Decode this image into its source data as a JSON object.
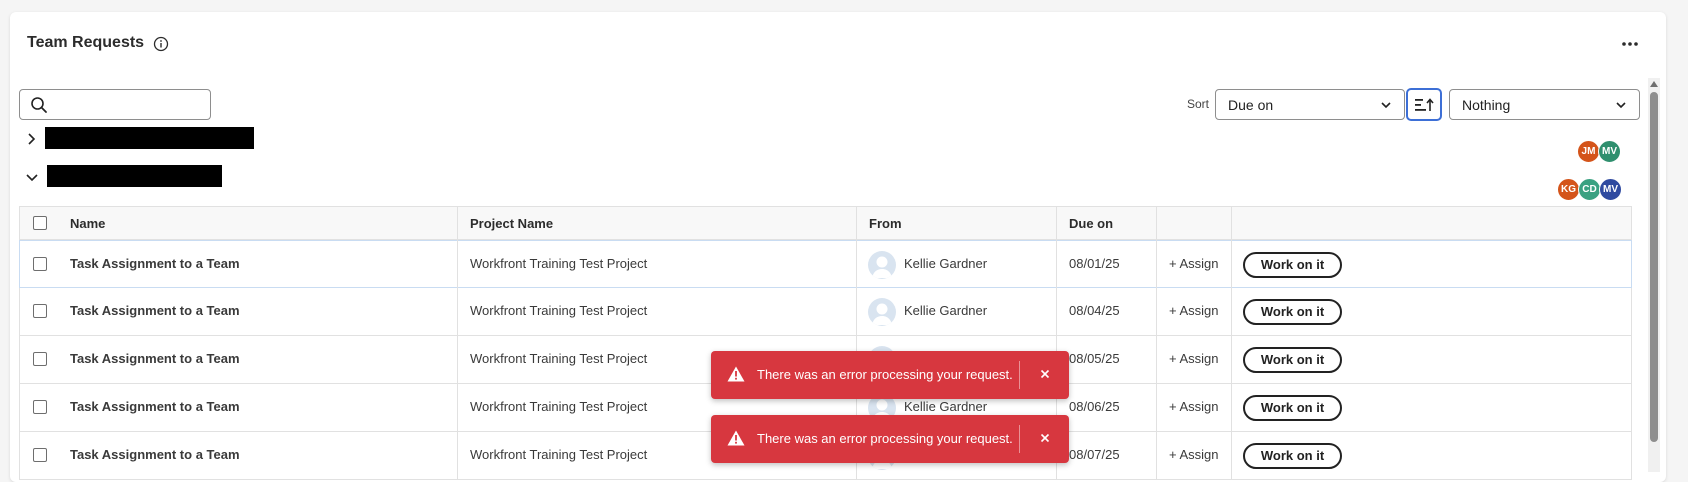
{
  "header": {
    "title": "Team Requests",
    "info_icon": "info-icon",
    "more_icon": "more-horizontal-icon"
  },
  "search": {
    "value": "",
    "placeholder": "",
    "icon": "search-icon"
  },
  "sort": {
    "label": "Sort",
    "field": "Due on",
    "direction_icon": "sort-ascending-icon",
    "group_by": "Nothing"
  },
  "groups": [
    {
      "name": "",
      "expanded": false,
      "avatars": [
        {
          "initials": "JM",
          "color": "#d4541a"
        },
        {
          "initials": "MV",
          "color": "#2f8f6e"
        }
      ]
    },
    {
      "name": "",
      "expanded": true,
      "avatars": [
        {
          "initials": "KG",
          "color": "#d4541a"
        },
        {
          "initials": "CD",
          "color": "#3aa181"
        },
        {
          "initials": "MV",
          "color": "#2f4aa0"
        }
      ]
    }
  ],
  "table": {
    "columns": [
      "Name",
      "Project Name",
      "From",
      "Due on",
      "",
      ""
    ],
    "rows": [
      {
        "name": "Task Assignment to a Team",
        "project": "Workfront Training Test Project",
        "from": "Kellie Gardner",
        "due": "08/01/25",
        "assign": "+ Assign",
        "action": "Work on it"
      },
      {
        "name": "Task Assignment to a Team",
        "project": "Workfront Training Test Project",
        "from": "Kellie Gardner",
        "due": "08/04/25",
        "assign": "+ Assign",
        "action": "Work on it"
      },
      {
        "name": "Task Assignment to a Team",
        "project": "Workfront Training Test Project",
        "from": "",
        "due": "08/05/25",
        "assign": "+ Assign",
        "action": "Work on it"
      },
      {
        "name": "Task Assignment to a Team",
        "project": "Workfront Training Test Project",
        "from": "Kellie Gardner",
        "due": "08/06/25",
        "assign": "+ Assign",
        "action": "Work on it"
      },
      {
        "name": "Task Assignment to a Team",
        "project": "Workfront Training Test Project",
        "from": "",
        "due": "08/07/25",
        "assign": "+ Assign",
        "action": "Work on it"
      }
    ]
  },
  "toasts": [
    {
      "message": "There was an error processing your request.",
      "icon": "alert-triangle-icon",
      "close_icon": "close-icon"
    },
    {
      "message": "There was an error processing your request.",
      "icon": "alert-triangle-icon",
      "close_icon": "close-icon"
    }
  ],
  "colors": {
    "toast_bg": "#d7373f",
    "focus_blue": "#3d6fd6"
  }
}
